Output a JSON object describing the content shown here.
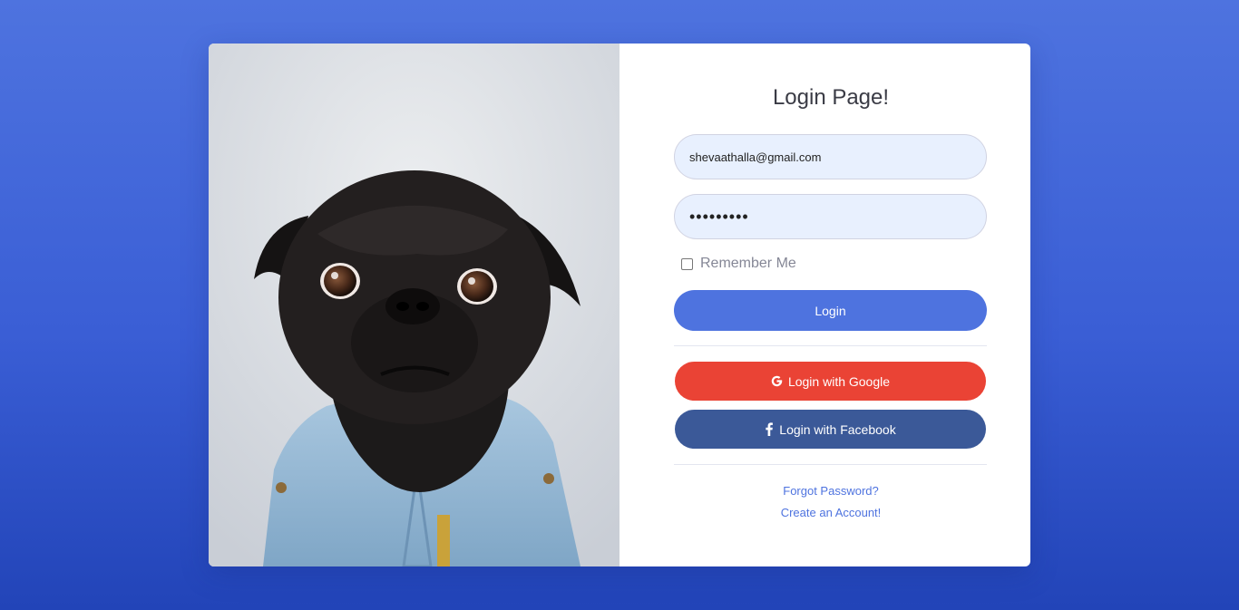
{
  "page": {
    "title": "Login Page!"
  },
  "form": {
    "email_value": "shevaathalla@gmail.com",
    "password_value": "•••••••••",
    "remember_label": "Remember Me",
    "remember_checked": false,
    "login_label": "Login",
    "google_label": "Login with Google",
    "facebook_label": "Login with Facebook"
  },
  "links": {
    "forgot": "Forgot Password?",
    "create": "Create an Account!"
  },
  "icons": {
    "google": "google-icon",
    "facebook": "facebook-icon"
  },
  "colors": {
    "background": "#4e73df",
    "primary": "#4e73df",
    "google": "#ea4335",
    "facebook": "#3b5998",
    "input_fill": "#e8f0fe"
  }
}
